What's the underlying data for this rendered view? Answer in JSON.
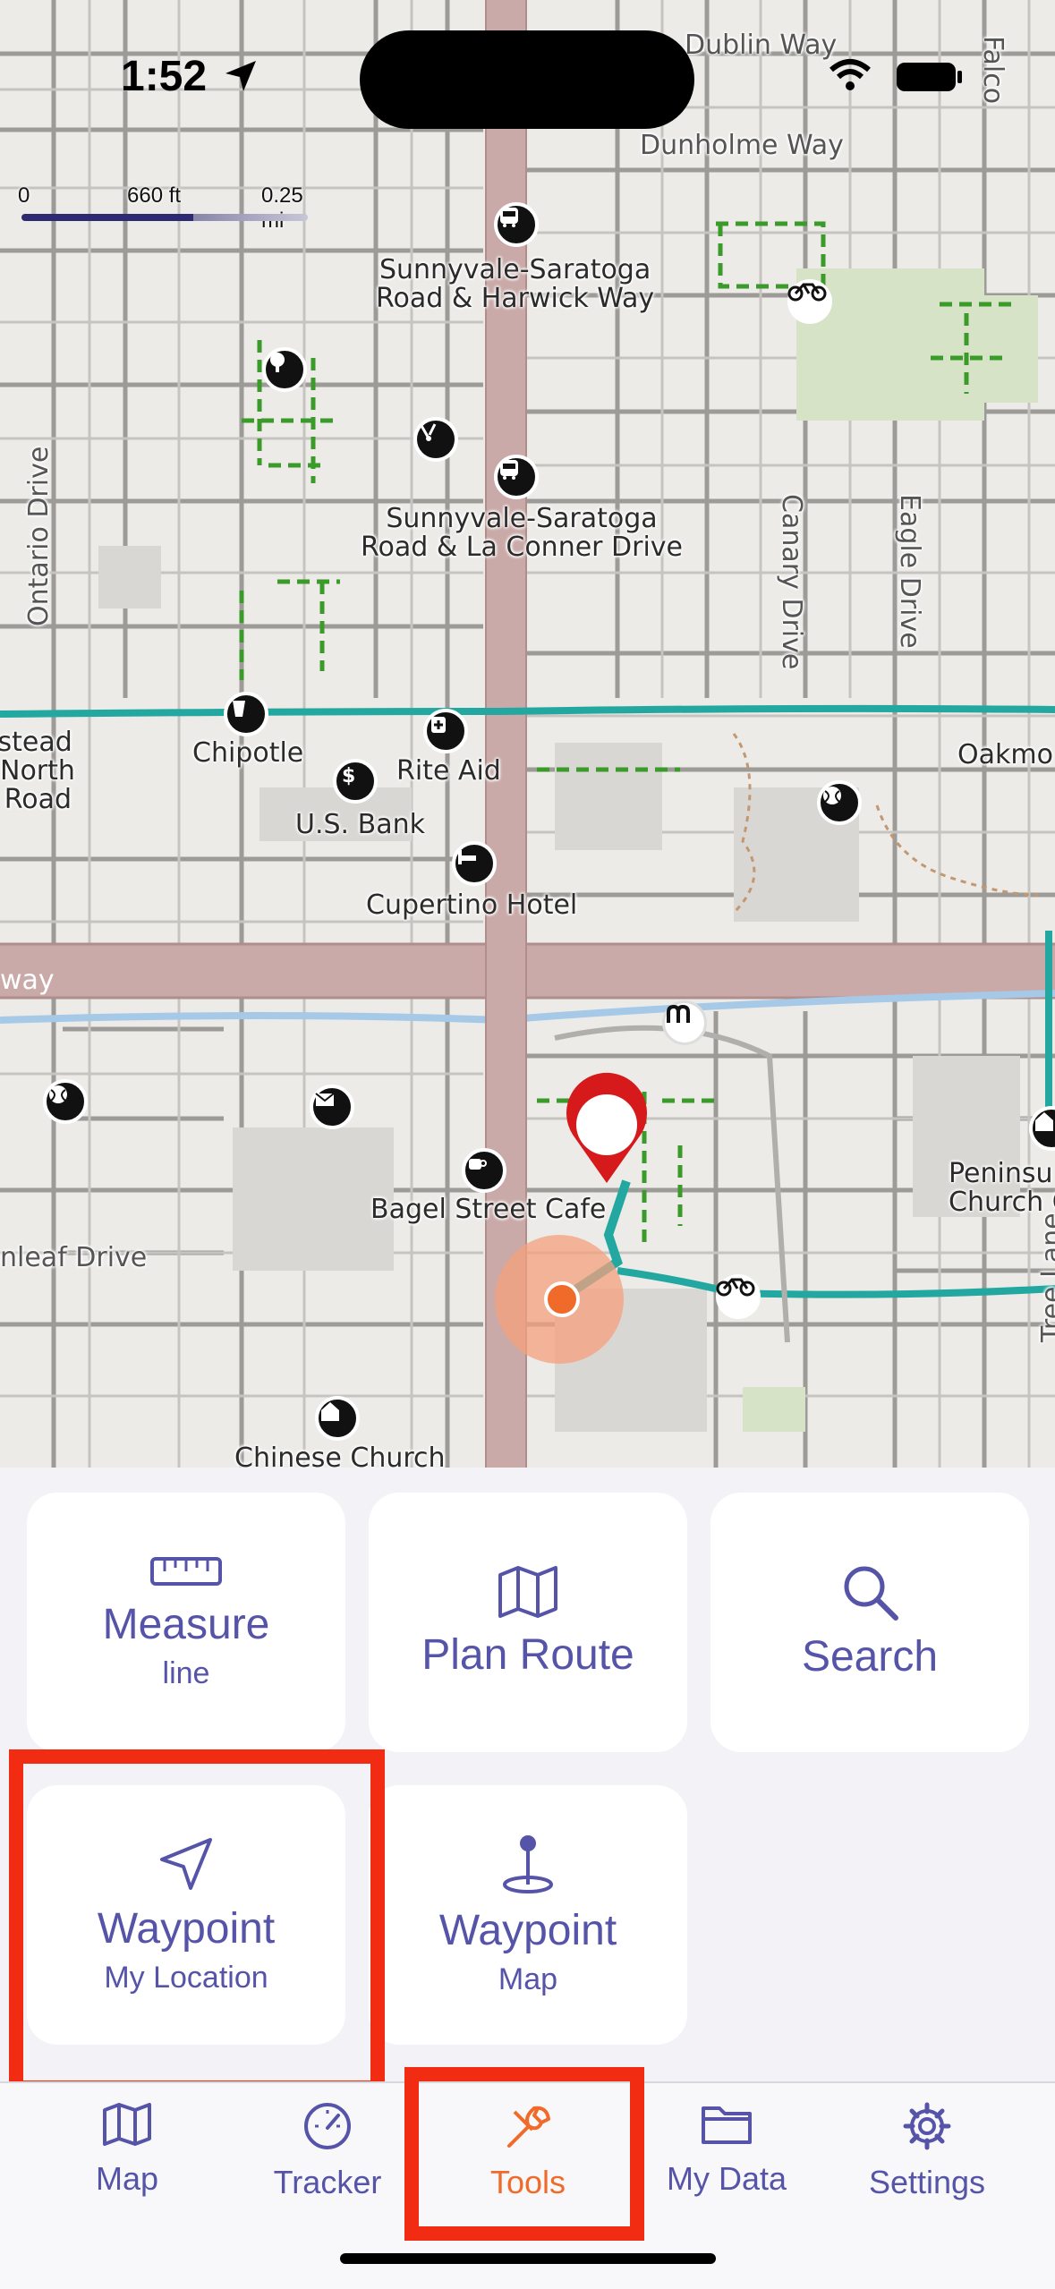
{
  "status_bar": {
    "time": "1:52"
  },
  "map": {
    "scale": {
      "zero": "0",
      "mid": "660 ft",
      "max": "0.25 mi"
    },
    "labels": {
      "dublin_way": "Dublin Way",
      "dunholme_way": "Dunholme Way",
      "falcon": "Falco",
      "stop1_line1": "Sunnyvale-Saratoga",
      "stop1_line2": "Road & Harwick Way",
      "stop2_line1": "Sunnyvale-Saratoga",
      "stop2_line2": "Road & La Conner Drive",
      "ontario": "Ontario Drive",
      "canary": "Canary Drive",
      "eagle": "Eagle Drive",
      "homestead_1": "nestead",
      "homestead_2": "North",
      "homestead_3": "Road",
      "chipotle": "Chipotle",
      "rite_aid": "Rite Aid",
      "us_bank": "U.S. Bank",
      "oakmont": "Oakmo",
      "cupertino_hotel": "Cupertino Hotel",
      "freeway": "way",
      "bagel": "Bagel Street Cafe",
      "peninsula_1": "Peninsu",
      "peninsula_2": "Church C",
      "leaf_drive": "nleaf Drive",
      "chinese_church": "Chinese Church",
      "tree_lane": "Tree Lane"
    }
  },
  "tools": {
    "measure": {
      "title": "Measure",
      "sub": "line",
      "icon": "ruler-icon"
    },
    "plan_route": {
      "title": "Plan Route",
      "icon": "map-icon"
    },
    "search": {
      "title": "Search",
      "icon": "search-icon"
    },
    "waypoint_location": {
      "title": "Waypoint",
      "sub": "My Location",
      "icon": "location-arrow-icon"
    },
    "waypoint_map": {
      "title": "Waypoint",
      "sub": "Map",
      "icon": "pin-icon"
    }
  },
  "tabs": [
    {
      "label": "Map",
      "icon": "map-icon"
    },
    {
      "label": "Tracker",
      "icon": "speedometer-icon"
    },
    {
      "label": "Tools",
      "icon": "wrench-icon",
      "active": true
    },
    {
      "label": "My Data",
      "icon": "folder-icon"
    },
    {
      "label": "Settings",
      "icon": "gear-icon"
    }
  ],
  "colors": {
    "accent": "#5654a8",
    "active_tab": "#f06a2a",
    "highlight": "#f22c12",
    "trail": "#22a8a0"
  }
}
